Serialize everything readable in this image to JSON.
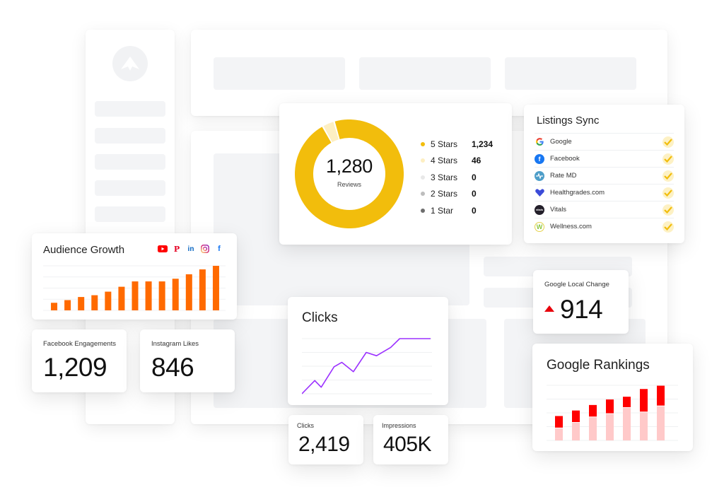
{
  "reviews": {
    "total": "1,280",
    "total_label": "Reviews",
    "legend": [
      {
        "label": "5 Stars",
        "value": "1,234",
        "color": "#f2bd0c"
      },
      {
        "label": "4 Stars",
        "value": "46",
        "color": "#fdefc2"
      },
      {
        "label": "3 Stars",
        "value": "0",
        "color": "#e8e8e8"
      },
      {
        "label": "2 Stars",
        "value": "0",
        "color": "#bdbdbd"
      },
      {
        "label": "1 Star",
        "value": "0",
        "color": "#6e6e6e"
      }
    ]
  },
  "listings": {
    "title": "Listings Sync",
    "items": [
      {
        "name": "Google",
        "icon": "google-icon",
        "synced": true
      },
      {
        "name": "Facebook",
        "icon": "facebook-icon",
        "synced": true
      },
      {
        "name": "Rate MD",
        "icon": "ratemd-icon",
        "synced": true
      },
      {
        "name": "Healthgrades.com",
        "icon": "healthgrades-icon",
        "synced": true
      },
      {
        "name": "Vitals",
        "icon": "vitals-icon",
        "synced": true
      },
      {
        "name": "Wellness.com",
        "icon": "wellness-icon",
        "synced": true
      }
    ],
    "check_color": "#f2bd0c"
  },
  "audience": {
    "title": "Audience Growth",
    "socials": [
      "youtube-icon",
      "pinterest-icon",
      "linkedin-icon",
      "instagram-icon",
      "facebook-icon"
    ],
    "bar_color": "#ff6a00"
  },
  "facebook_engagements": {
    "label": "Facebook Engagements",
    "value": "1,209"
  },
  "instagram_likes": {
    "label": "Instagram Likes",
    "value": "846"
  },
  "clicks_chart": {
    "title": "Clicks",
    "line_color": "#9b30ff"
  },
  "clicks_stat": {
    "label": "Clicks",
    "value": "2,419"
  },
  "impressions_stat": {
    "label": "Impressions",
    "value": "405K"
  },
  "google_local_change": {
    "label": "Google Local Change",
    "value": "914",
    "direction": "up",
    "arrow_color": "#e8000b"
  },
  "google_rankings": {
    "title": "Google Rankings",
    "base_color": "#ffc9c9",
    "top_color": "#ff0000"
  },
  "chart_data": [
    {
      "type": "pie",
      "title": "Reviews",
      "categories": [
        "5 Stars",
        "4 Stars",
        "3 Stars",
        "2 Stars",
        "1 Star"
      ],
      "values": [
        1234,
        46,
        0,
        0,
        0
      ],
      "donut": true
    },
    {
      "type": "bar",
      "title": "Audience Growth",
      "categories": [
        "1",
        "2",
        "3",
        "4",
        "5",
        "6",
        "7",
        "8",
        "9",
        "10",
        "11",
        "12",
        "13"
      ],
      "values": [
        17,
        23,
        30,
        34,
        42,
        53,
        65,
        65,
        65,
        71,
        81,
        92,
        100
      ],
      "ylim": [
        0,
        100
      ],
      "grid": true
    },
    {
      "type": "line",
      "title": "Clicks",
      "x": [
        0,
        10,
        15,
        25,
        31,
        40,
        50,
        58,
        69,
        76,
        88,
        100
      ],
      "values": [
        0,
        24,
        12,
        49,
        57,
        40,
        75,
        69,
        84,
        100,
        100,
        100
      ],
      "ylim": [
        0,
        100
      ],
      "grid": true
    },
    {
      "type": "bar",
      "title": "Google Rankings",
      "stacked": true,
      "categories": [
        "1",
        "2",
        "3",
        "4",
        "5",
        "6",
        "7"
      ],
      "series": [
        {
          "name": "base",
          "values": [
            22,
            32,
            42,
            48,
            59,
            51,
            62
          ]
        },
        {
          "name": "change",
          "values": [
            21,
            21,
            21,
            25,
            19,
            41,
            36
          ]
        }
      ],
      "ylim": [
        0,
        100
      ],
      "grid": true
    }
  ]
}
